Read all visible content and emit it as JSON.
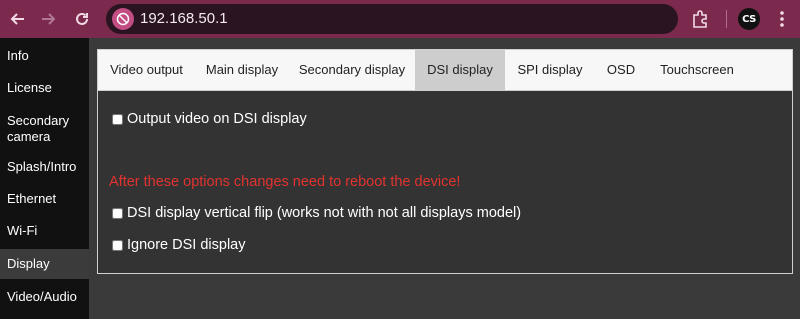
{
  "browser": {
    "url": "192.168.50.1",
    "profile_initials": "CS"
  },
  "sidebar": {
    "items": [
      {
        "label": "Info"
      },
      {
        "label": "License"
      },
      {
        "label": "Secondary camera"
      },
      {
        "label": "Splash/Intro"
      },
      {
        "label": "Ethernet"
      },
      {
        "label": "Wi-Fi"
      },
      {
        "label": "Display",
        "active": true
      },
      {
        "label": "Video/Audio"
      }
    ]
  },
  "tabs": [
    {
      "label": "Video output"
    },
    {
      "label": "Main display"
    },
    {
      "label": "Secondary display"
    },
    {
      "label": "DSI display",
      "active": true
    },
    {
      "label": "SPI display"
    },
    {
      "label": "OSD"
    },
    {
      "label": "Touchscreen"
    }
  ],
  "dsi": {
    "output_label": "Output video on DSI display",
    "warning": "After these options changes need to reboot the device!",
    "flip_label": "DSI display vertical flip (works not with not all displays model)",
    "ignore_label": "Ignore DSI display"
  },
  "colors": {
    "chrome": "#7b2a4e",
    "sidebar": "#111111",
    "content": "#333333",
    "warning": "#e2332f"
  },
  "icons": [
    "back-arrow-icon",
    "forward-arrow-icon",
    "reload-icon",
    "site-info-icon",
    "extensions-icon",
    "more-vert-icon"
  ]
}
